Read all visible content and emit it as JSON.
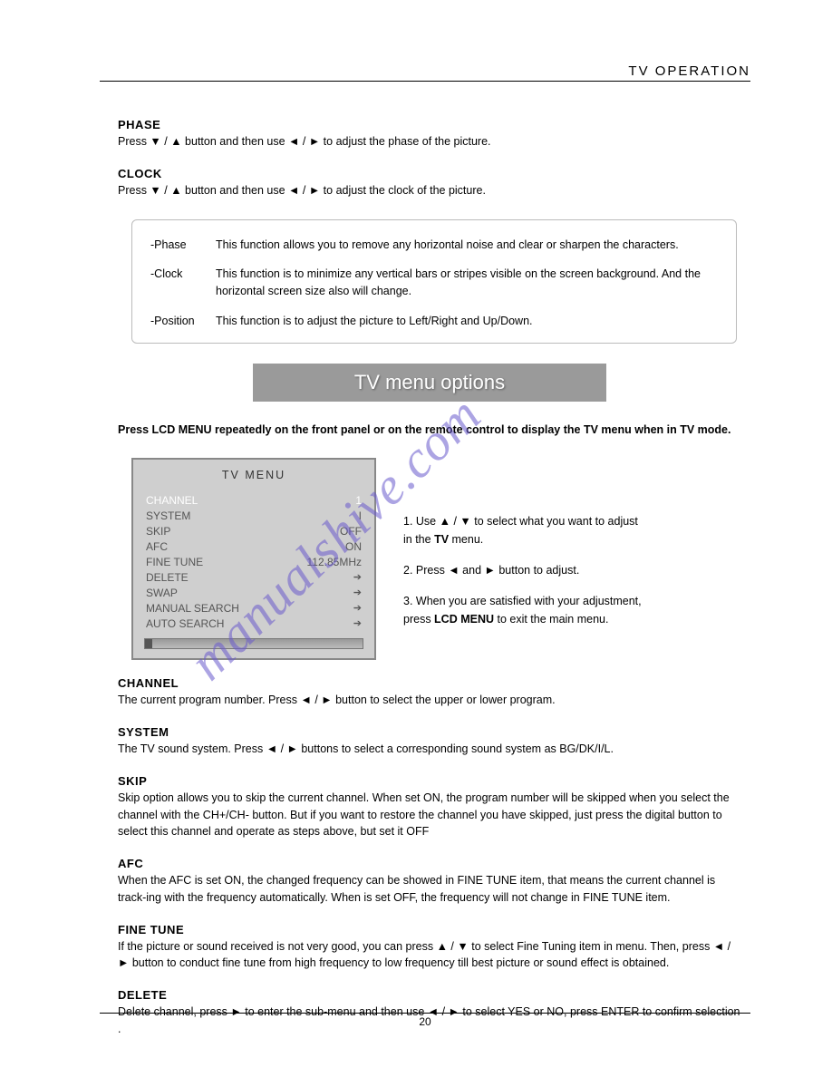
{
  "header": {
    "title": "TV  OPERATION"
  },
  "phase": {
    "title": "PHASE",
    "body": "Press ▼ / ▲ button and then use ◄ / ► to adjust the phase of the picture."
  },
  "clock": {
    "title": "CLOCK",
    "body": "Press ▼ / ▲ button and then use ◄ / ► to adjust the clock of the picture."
  },
  "box": {
    "phase_label": "-Phase",
    "phase_text": "This function allows you to remove any horizontal noise and clear or sharpen the characters.",
    "clock_label": "-Clock",
    "clock_text": "This function is to minimize any vertical bars or stripes visible on the screen background. And the horizontal screen size also will change.",
    "pos_label": "-Position",
    "pos_text": "This function is to adjust the picture to Left/Right and Up/Down."
  },
  "banner": "TV menu options",
  "intro": "Press LCD MENU repeatedly on the front panel or on the remote control to display the TV menu when in TV mode.",
  "tv_menu": {
    "title": "TV  MENU",
    "items": [
      {
        "label": "CHANNEL",
        "value": "1",
        "hl": true
      },
      {
        "label": "SYSTEM",
        "value": "I"
      },
      {
        "label": "SKIP",
        "value": "OFF"
      },
      {
        "label": "AFC",
        "value": "ON"
      },
      {
        "label": "FINE TUNE",
        "value": "112.85MHz"
      },
      {
        "label": "DELETE",
        "value": "➔"
      },
      {
        "label": "SWAP",
        "value": "➔"
      },
      {
        "label": "MANUAL SEARCH",
        "value": "➔"
      },
      {
        "label": "AUTO SEARCH",
        "value": "➔"
      }
    ]
  },
  "steps": {
    "s1a": "1. Use ▲ / ▼ to select what you want to adjust",
    "s1b": "    in the ",
    "s1c": "TV",
    "s1d": " menu.",
    "s2": "2. Press ◄ and ► button to adjust.",
    "s3a": "3. When you are satisfied with your adjustment,",
    "s3b": "    press ",
    "s3c": "LCD MENU",
    "s3d": " to exit the main menu."
  },
  "channel": {
    "title": "CHANNEL",
    "body": "The current program number. Press ◄ / ► button to select the upper or lower program."
  },
  "system": {
    "title": "SYSTEM",
    "body": "The TV sound system. Press ◄ / ► buttons to select a corresponding sound system as BG/DK/I/L."
  },
  "skip": {
    "title": "SKIP",
    "body": "Skip option allows you to skip the current channel. When set ON, the program number will be skipped when you select the channel with the CH+/CH- button. But if you want to restore the channel you have skipped, just press the digital button to select this channel and operate as steps above, but set it OFF"
  },
  "afc": {
    "title": "AFC",
    "body": "When the AFC is set ON, the changed frequency can be showed in FINE TUNE item, that means the current channel is track-ing with the frequency automatically. When is set OFF, the frequency will not change in FINE TUNE item."
  },
  "finetune": {
    "title": "FINE TUNE",
    "body": "If the picture or sound received is not very good, you can press ▲ / ▼ to select Fine Tuning item in menu. Then, press ◄ / ► button to conduct fine tune from high frequency to low frequency till best picture or sound effect is obtained."
  },
  "delete": {
    "title": "DELETE",
    "body": "Delete channel, press ► to enter the sub-menu and then use ◄ / ► to select YES or NO, press ENTER to confirm selection ."
  },
  "watermark": "manualshive.com",
  "page_number": "20"
}
